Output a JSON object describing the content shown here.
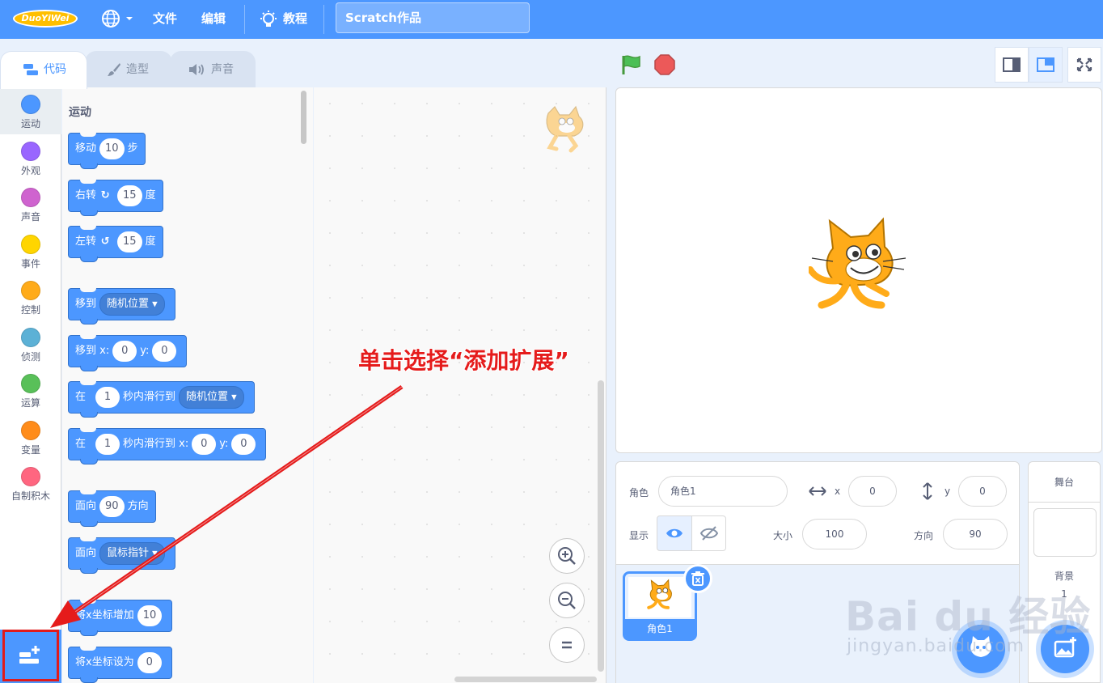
{
  "menubar": {
    "logo_text": "DuoYiWei",
    "file": "文件",
    "edit": "编辑",
    "tutorials": "教程",
    "project_title": "Scratch作品"
  },
  "tabs": [
    {
      "label": "代码"
    },
    {
      "label": "造型"
    },
    {
      "label": "声音"
    }
  ],
  "categories": [
    {
      "label": "运动",
      "color": "#4c97ff"
    },
    {
      "label": "外观",
      "color": "#9966ff"
    },
    {
      "label": "声音",
      "color": "#cf63cf"
    },
    {
      "label": "事件",
      "color": "#ffd500"
    },
    {
      "label": "控制",
      "color": "#ffab19"
    },
    {
      "label": "侦测",
      "color": "#5cb1d6"
    },
    {
      "label": "运算",
      "color": "#59c059"
    },
    {
      "label": "变量",
      "color": "#ff8c1a"
    },
    {
      "label": "自制积木",
      "color": "#ff6680"
    }
  ],
  "palette": {
    "section_title": "运动",
    "blocks": {
      "move": {
        "label": "移动",
        "value": "10",
        "suffix": "步"
      },
      "turn_right": {
        "label": "右转",
        "value": "15",
        "suffix": "度"
      },
      "turn_left": {
        "label": "左转",
        "value": "15",
        "suffix": "度"
      },
      "goto": {
        "label": "移到",
        "dropdown": "随机位置"
      },
      "goto_xy": {
        "label": "移到 x:",
        "x": "0",
        "ylabel": "y:",
        "y": "0"
      },
      "glide": {
        "prefix": "在",
        "value": "1",
        "mid": "秒内滑行到",
        "dropdown": "随机位置"
      },
      "glide_xy": {
        "prefix": "在",
        "value": "1",
        "mid": "秒内滑行到 x:",
        "x": "0",
        "ylabel": "y:",
        "y": "0"
      },
      "point_dir": {
        "label": "面向",
        "value": "90",
        "suffix": "方向"
      },
      "point_towards": {
        "label": "面向",
        "dropdown": "鼠标指针"
      },
      "change_x": {
        "label": "将x坐标增加",
        "value": "10"
      },
      "set_x": {
        "label": "将x坐标设为",
        "value": "0"
      }
    }
  },
  "annotation": "单击选择“添加扩展”",
  "sprite_info": {
    "sprite_label": "角色",
    "sprite_name": "角色1",
    "x_label": "x",
    "x": "0",
    "y_label": "y",
    "y": "0",
    "show_label": "显示",
    "size_label": "大小",
    "size": "100",
    "direction_label": "方向",
    "direction": "90"
  },
  "sprite_list": [
    {
      "name": "角色1"
    }
  ],
  "stage_pane": {
    "title": "舞台",
    "backdrops_label": "背景",
    "backdrops_count": "1"
  },
  "watermark": {
    "main": "Bai du 经验",
    "url": "jingyan.baidu.com"
  },
  "colors": {
    "motion": "#4c97ff",
    "menubar": "#4c97ff",
    "annotation": "#e51b1b"
  }
}
